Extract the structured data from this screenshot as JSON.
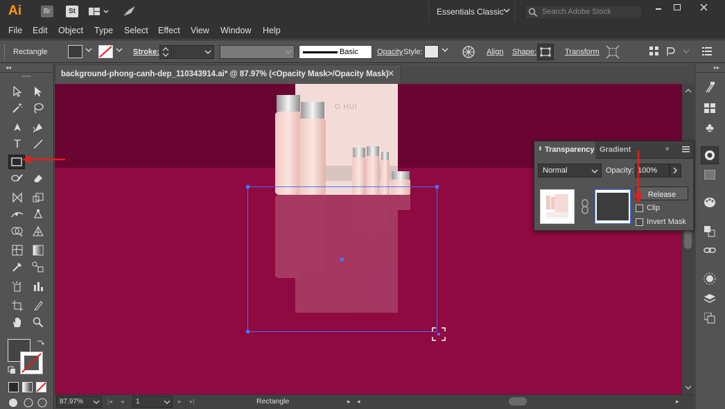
{
  "app": {
    "logo": "Ai",
    "bridge": "Br",
    "stock": "St",
    "workspace": "Essentials Classic",
    "search_placeholder": "Search Adobe Stock"
  },
  "menu": [
    "File",
    "Edit",
    "Object",
    "Type",
    "Select",
    "Effect",
    "View",
    "Window",
    "Help"
  ],
  "control_bar": {
    "selection": "Rectangle",
    "stroke_label": "Stroke:",
    "brush_label": "Basic",
    "opacity_label": "Opacity",
    "style_label": "Style:",
    "align_label": "Align",
    "shape_label": "Shape:",
    "transform_label": "Transform"
  },
  "document": {
    "tab_title": "background-phong-canh-dep_110343914.ai* @ 87.97% (<Opacity Mask>/Opacity Mask)",
    "close": "✕",
    "zoom": "87.97%",
    "artboard": "1",
    "status": "Rectangle"
  },
  "artwork": {
    "brand": "O HUI"
  },
  "transparency_panel": {
    "tab_active": "Transparency",
    "tab_inactive": "Gradient",
    "blend_mode": "Normal",
    "opacity_label": "Opacity:",
    "opacity_value": "100%",
    "release_button": "Release",
    "clip_label": "Clip",
    "invert_label": "Invert Mask",
    "clip_checked": false,
    "invert_checked": false
  },
  "colors": {
    "canvas_top": "#6a0531",
    "canvas_bottom": "#8e0a40",
    "selection": "#4a6fff",
    "annotation_arrow": "#e02020",
    "ui_dark": "#323232",
    "ui_mid": "#535353"
  },
  "icons": {
    "toolbar": [
      "selection-tool-icon",
      "direct-selection-tool-icon",
      "magic-wand-icon",
      "lasso-icon",
      "pen-tool-icon",
      "curvature-tool-icon",
      "type-tool-icon",
      "line-segment-icon",
      "rectangle-tool-icon",
      "paintbrush-icon",
      "shaper-tool-icon",
      "eraser-icon",
      "rotate-tool-icon",
      "scale-tool-icon",
      "width-tool-icon",
      "free-transform-icon",
      "shape-builder-icon",
      "perspective-grid-icon",
      "mesh-tool-icon",
      "gradient-tool-icon",
      "eyedropper-icon",
      "blend-tool-icon",
      "symbol-sprayer-icon",
      "column-graph-icon",
      "artboard-tool-icon",
      "slice-tool-icon",
      "hand-tool-icon",
      "zoom-tool-icon"
    ],
    "dock": [
      "brushes-icon",
      "swatches-icon",
      "symbols-icon",
      "transparency-icon",
      "gradient-icon",
      "color-icon",
      "pathfinder-icon",
      "links-icon",
      "appearance-icon",
      "layers-icon",
      "artboards-icon"
    ]
  }
}
